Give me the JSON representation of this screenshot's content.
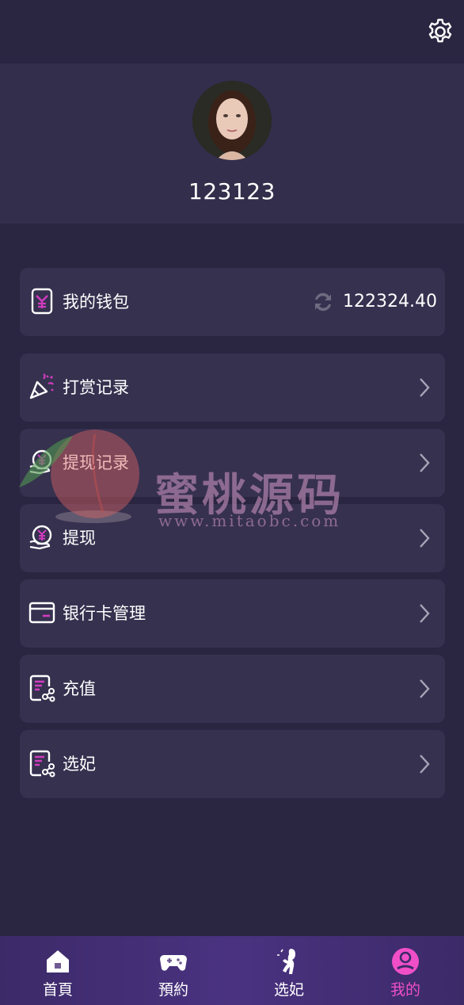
{
  "header": {
    "settings_icon": "gear-icon"
  },
  "profile": {
    "username": "123123",
    "avatar": "profile-photo"
  },
  "wallet": {
    "label": "我的钱包",
    "amount": "122324.40",
    "icon": "wallet-icon",
    "refresh_icon": "refresh-icon"
  },
  "menu": [
    {
      "label": "打赏记录",
      "icon": "party-popper-icon"
    },
    {
      "label": "提现记录",
      "icon": "yuan-hand-icon"
    },
    {
      "label": "提现",
      "icon": "yuan-hand-icon"
    },
    {
      "label": "银行卡管理",
      "icon": "bank-card-icon"
    },
    {
      "label": "充值",
      "icon": "document-link-icon"
    },
    {
      "label": "选妃",
      "icon": "document-link-icon"
    }
  ],
  "watermark": {
    "title": "蜜桃源码",
    "url": "www.mitaobc.com"
  },
  "tabs": [
    {
      "label": "首頁",
      "icon": "home-icon"
    },
    {
      "label": "預約",
      "icon": "gamepad-icon"
    },
    {
      "label": "选妃",
      "icon": "woman-silhouette-icon"
    },
    {
      "label": "我的",
      "icon": "user-icon"
    }
  ],
  "colors": {
    "background": "#2a2540",
    "card": "#36314f",
    "accent": "#f04fc8",
    "tabbar": "#4a3280"
  }
}
